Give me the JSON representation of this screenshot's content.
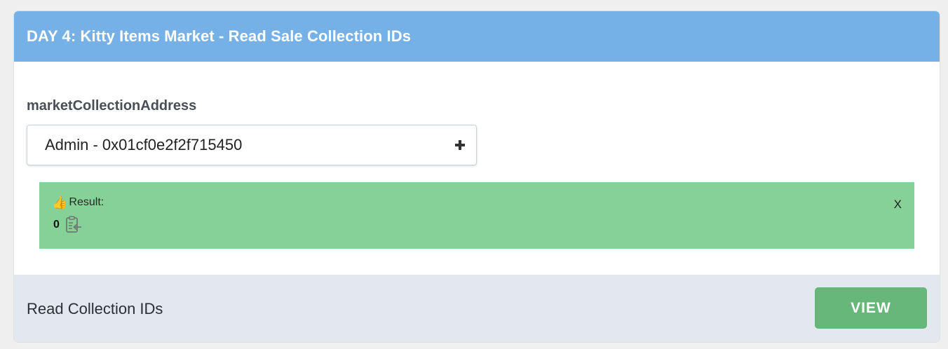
{
  "header": {
    "title": "DAY 4: Kitty Items Market - Read Sale Collection IDs"
  },
  "form": {
    "field_label": "marketCollectionAddress",
    "address_value": "Admin - 0x01cf0e2f2f715450",
    "add_icon": "plus-icon"
  },
  "result": {
    "icon": "thumbs-up-icon",
    "label": "Result:",
    "value": "0",
    "copy_icon": "copy-clipboard-icon",
    "close_label": "X"
  },
  "footer": {
    "label": "Read Collection IDs",
    "button_label": "VIEW"
  },
  "colors": {
    "header_bg": "#75b1e7",
    "result_bg": "#86d197",
    "footer_bg": "#e3e7ef",
    "button_bg": "#67b67a"
  }
}
